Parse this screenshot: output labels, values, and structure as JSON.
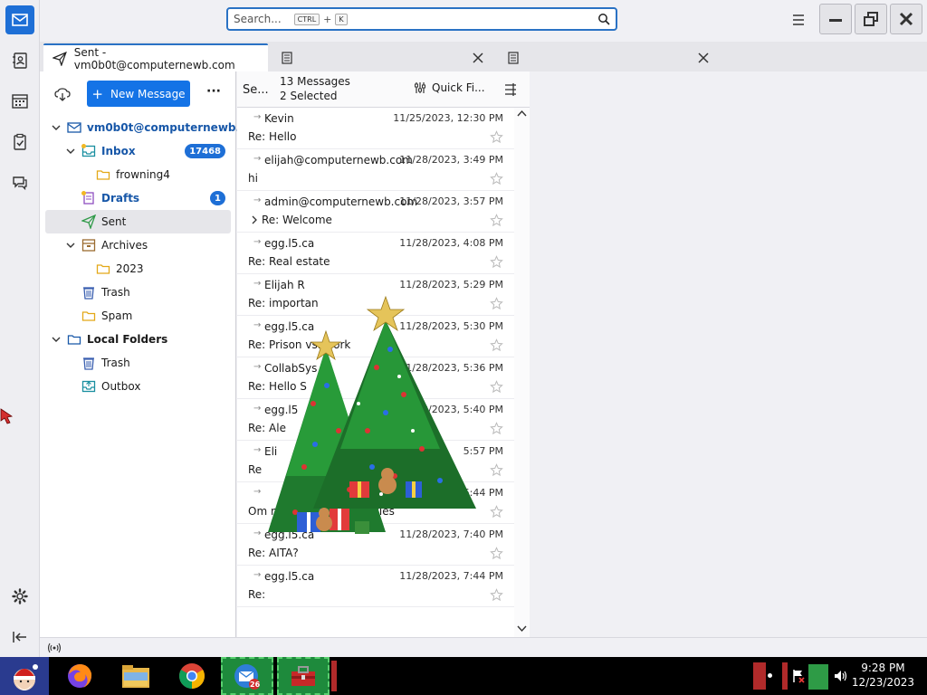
{
  "app": {
    "title": "Sent - vm0b0t@computernewb.com"
  },
  "search": {
    "placeholder": "Search...",
    "key1": "CTRL",
    "plus": "+",
    "key2": "K"
  },
  "tabs": [
    {
      "label": "Sent - vm0b0t@computernewb.com",
      "icon": "paper-plane-icon",
      "active": true
    },
    {
      "label": "",
      "icon": "document-icon",
      "active": false
    },
    {
      "label": "",
      "icon": "document-icon",
      "active": false
    }
  ],
  "folder_pane": {
    "new_message_label": "New Message",
    "more_label": "···"
  },
  "folders": [
    {
      "label": "vm0b0t@computernewb...",
      "level": 0,
      "icon": "mail-account-icon",
      "bold": true,
      "blue": true,
      "expanded": true,
      "badge": ""
    },
    {
      "label": "Inbox",
      "level": 1,
      "icon": "inbox-icon",
      "bold": true,
      "blue": true,
      "expanded": true,
      "badge": "17468"
    },
    {
      "label": "frowning4",
      "level": 2,
      "icon": "folder-icon",
      "bold": false,
      "blue": false,
      "badge": ""
    },
    {
      "label": "Drafts",
      "level": 1,
      "icon": "drafts-icon",
      "bold": true,
      "blue": true,
      "badge": "1"
    },
    {
      "label": "Sent",
      "level": 1,
      "icon": "sent-icon",
      "bold": false,
      "blue": false,
      "selected": true,
      "badge": ""
    },
    {
      "label": "Archives",
      "level": 1,
      "icon": "archive-icon",
      "bold": false,
      "blue": false,
      "expanded": true,
      "badge": ""
    },
    {
      "label": "2023",
      "level": 2,
      "icon": "folder-icon",
      "bold": false,
      "blue": false,
      "badge": ""
    },
    {
      "label": "Trash",
      "level": 1,
      "icon": "trash-icon",
      "bold": false,
      "blue": false,
      "badge": ""
    },
    {
      "label": "Spam",
      "level": 1,
      "icon": "folder-icon",
      "bold": false,
      "blue": false,
      "badge": ""
    },
    {
      "label": "Local Folders",
      "level": 0,
      "icon": "local-folders-icon",
      "bold": true,
      "blue": false,
      "expanded": true,
      "badge": ""
    },
    {
      "label": "Trash",
      "level": 1,
      "icon": "trash-icon",
      "bold": false,
      "blue": false,
      "badge": ""
    },
    {
      "label": "Outbox",
      "level": 1,
      "icon": "outbox-icon",
      "bold": false,
      "blue": false,
      "badge": ""
    }
  ],
  "message_list": {
    "folder_short": "Se...",
    "count": "13 Messages",
    "selected": "2 Selected",
    "quick_filter": "Quick Fi...",
    "messages": [
      {
        "from": "Kevin",
        "date": "11/25/2023, 12:30 PM",
        "subject": "Re: Hello"
      },
      {
        "from": "elijah@computernewb.com",
        "date": "11/28/2023, 3:49 PM",
        "subject": "hi"
      },
      {
        "from": "admin@computernewb.com",
        "date": "11/28/2023, 3:57 PM",
        "subject": "Re: Welcome",
        "thread": true
      },
      {
        "from": "egg.l5.ca",
        "date": "11/28/2023, 4:08 PM",
        "subject": "Re: Real estate"
      },
      {
        "from": "Elijah R",
        "date": "11/28/2023, 5:29 PM",
        "subject": "Re: importan"
      },
      {
        "from": "egg.l5.ca",
        "date": "11/28/2023, 5:30 PM",
        "subject": "Re: Prison vs. work"
      },
      {
        "from": "CollabSys",
        "date": "11/28/2023, 5:36 PM",
        "subject": "Re: Hello S"
      },
      {
        "from": "egg.l5",
        "date": "11/28/2023, 5:40 PM",
        "subject": "Re: Ale"
      },
      {
        "from": "Eli",
        "date": "5:57 PM",
        "subject": "Re"
      },
      {
        "from": "",
        "date": "28/2023, 6:44 PM",
        "subject": "Om nom nom your cookies"
      },
      {
        "from": "egg.l5.ca",
        "date": "11/28/2023, 7:40 PM",
        "subject": "Re: AITA?"
      },
      {
        "from": "egg.l5.ca",
        "date": "11/28/2023, 7:44 PM",
        "subject": "Re:"
      }
    ]
  },
  "taskbar": {
    "time": "9:28 PM",
    "date": "12/23/2023",
    "mail_badge": "26"
  },
  "colors": {
    "accent": "#1473e6",
    "focus": "#2a72c4",
    "badge": "#1e6fd6"
  }
}
